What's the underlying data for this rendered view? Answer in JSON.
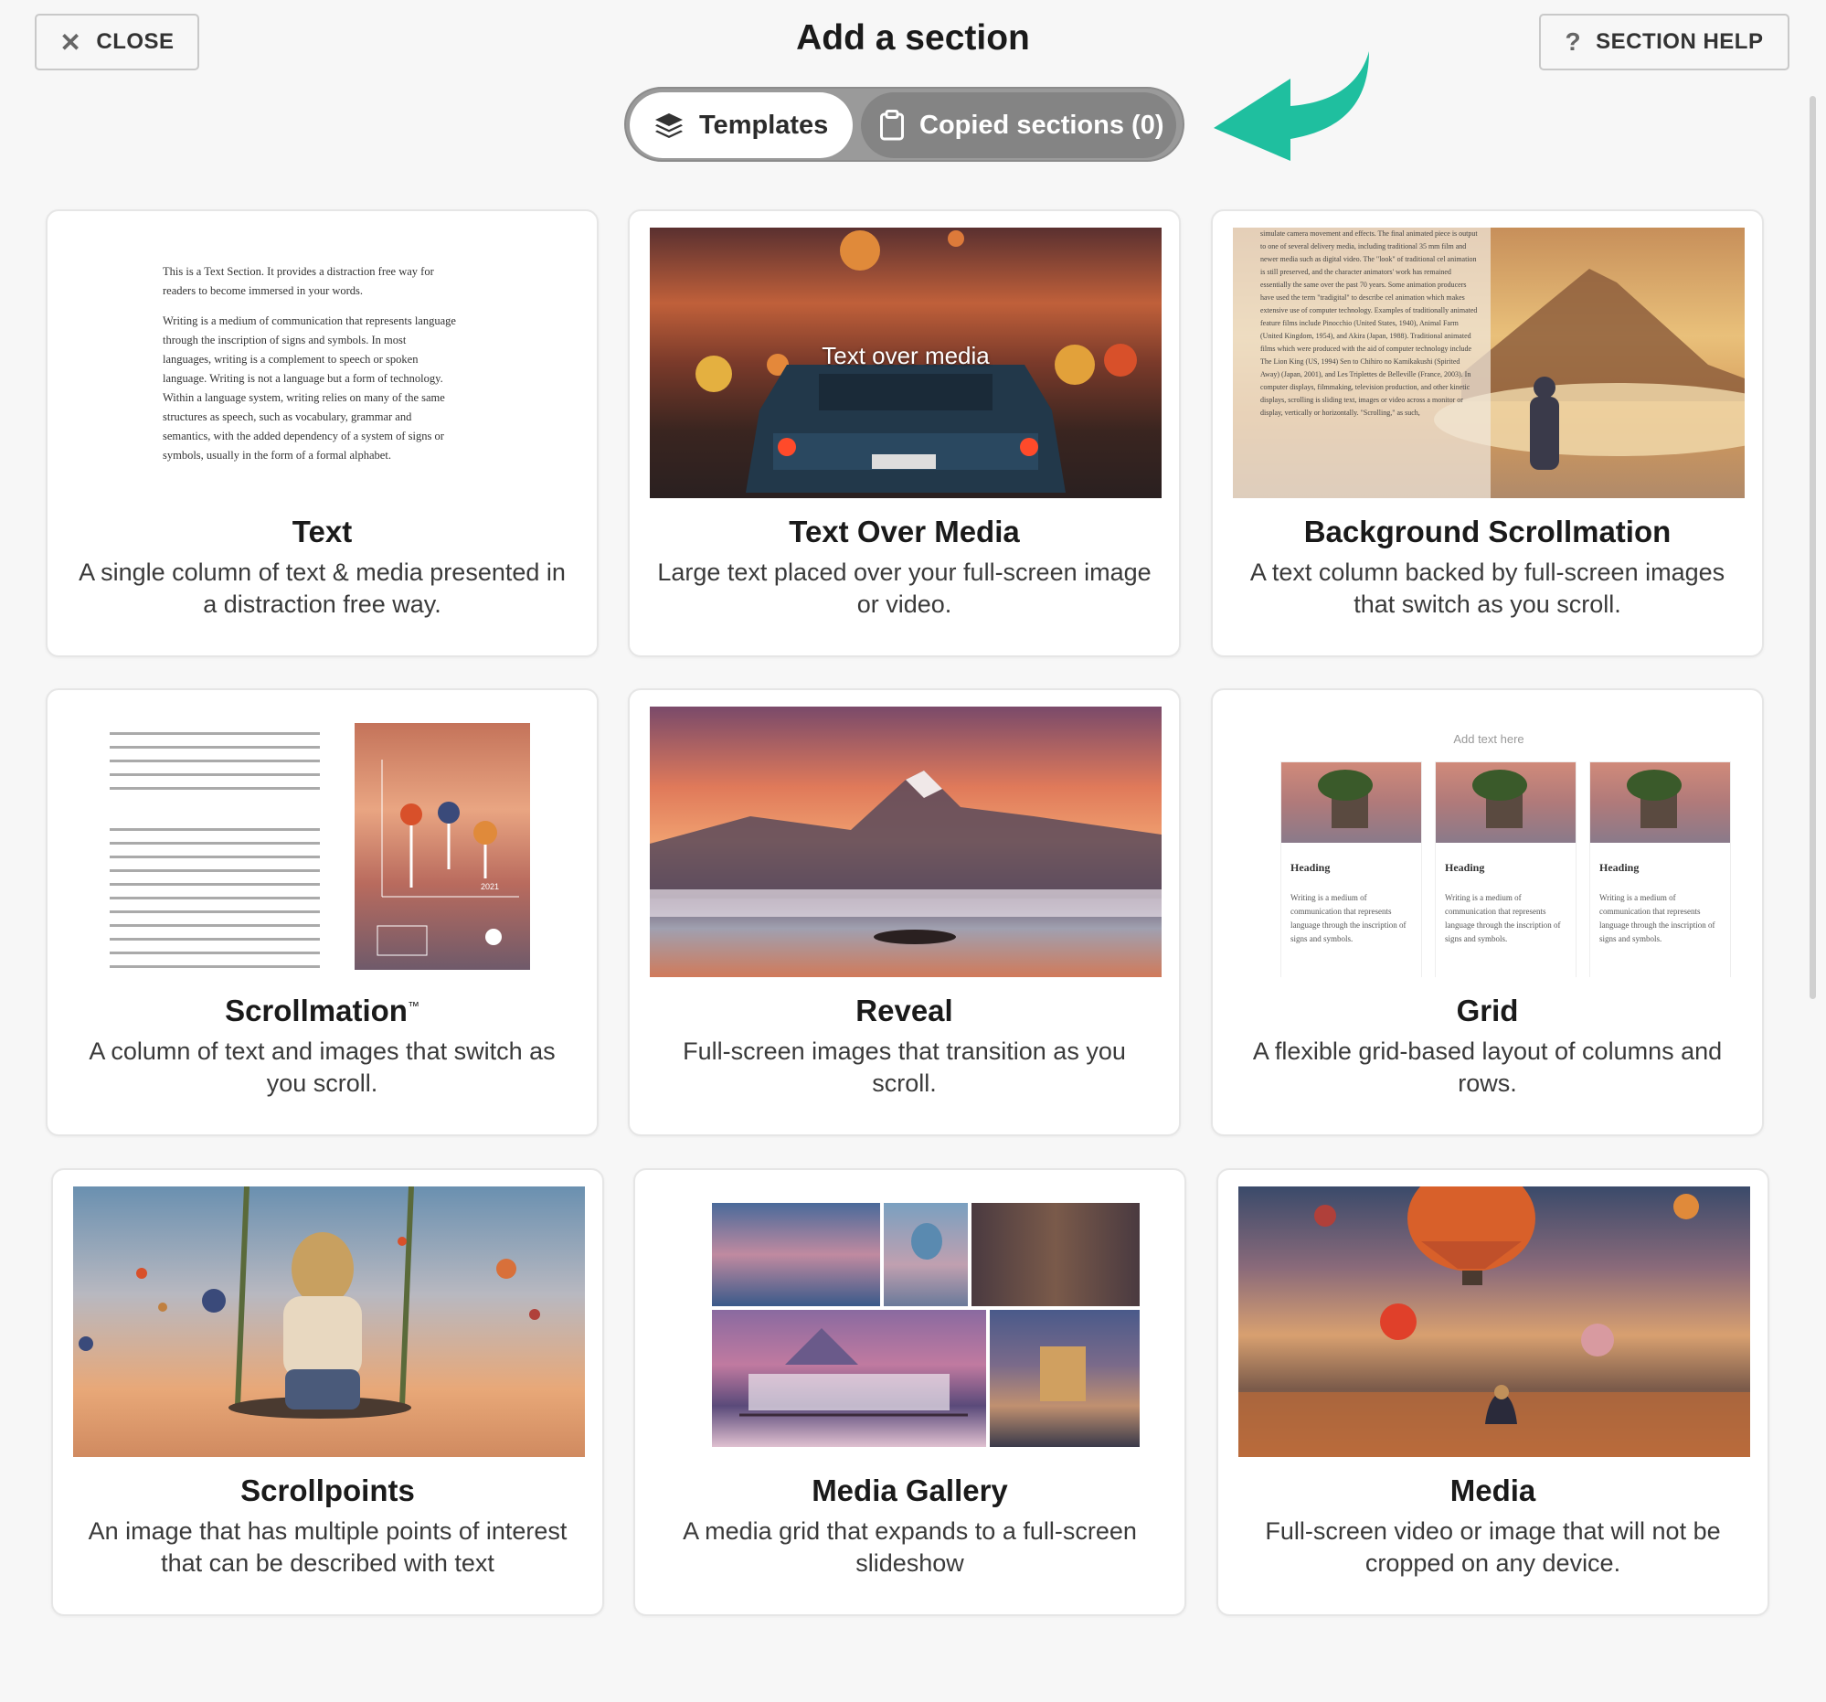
{
  "header": {
    "close_label": "CLOSE",
    "title": "Add a section",
    "help_label": "SECTION HELP"
  },
  "tabs": {
    "templates_label": "Templates",
    "copied_label": "Copied sections (0)"
  },
  "colors": {
    "accent_arrow": "#1fbf9f",
    "toggle_bg": "#9a9a9a"
  },
  "cards": [
    {
      "title": "Text",
      "desc": "A single column of text & media presented in a distraction free way."
    },
    {
      "title": "Text Over Media",
      "desc": "Large text placed over your full-screen image or video.",
      "overlay": "Text over media"
    },
    {
      "title": "Background Scrollmation",
      "desc": "A text column backed by full-screen images that switch as you scroll."
    },
    {
      "title": "Scrollmation",
      "title_mark": "™",
      "desc": "A column of text and images that switch as you scroll.",
      "chart_year": "2021"
    },
    {
      "title": "Reveal",
      "desc": "Full-screen images that transition as you scroll."
    },
    {
      "title": "Grid",
      "desc": "A flexible grid-based layout of columns and rows.",
      "add_text": "Add text here",
      "col_heading": "Heading",
      "col_text": "Writing is a medium of communication that represents language through the inscription of signs and symbols."
    },
    {
      "title": "Scrollpoints",
      "desc": "An image that has multiple points of interest that can be described with text"
    },
    {
      "title": "Media Gallery",
      "desc": "A media grid that expands to a full-screen slideshow"
    },
    {
      "title": "Media",
      "desc": "Full-screen video or image that will not be cropped on any device."
    }
  ],
  "text_thumb": {
    "p1": "This is a Text Section. It provides a distraction free way for readers to become immersed in your words.",
    "p2": "Writing is a medium of communication that represents language through the inscription of signs and symbols. In most languages, writing is a complement to speech or spoken language. Writing is not a language but a form of technology. Within a language system, writing relies on many of the same structures as speech, such as vocabulary, grammar and semantics, with the added dependency of a system of signs or symbols, usually in the form of a formal alphabet."
  },
  "bg_thumb": {
    "text": "simulate camera movement and effects. The final animated piece is output to one of several delivery media, including traditional 35 mm film and newer media such as digital video. The \"look\" of traditional cel animation is still preserved, and the character animators' work has remained essentially the same over the past 70 years. Some animation producers have used the term \"tradigital\" to describe cel animation which makes extensive use of computer technology. Examples of traditionally animated feature films include Pinocchio (United States, 1940), Animal Farm (United Kingdom, 1954), and Akira (Japan, 1988). Traditional animated films which were produced with the aid of computer technology include The Lion King (US, 1994) Sen to Chihiro no Kamikakushi (Spirited Away) (Japan, 2001), and Les Triplettes de Belleville (France, 2003). In computer displays, filmmaking, television production, and other kinetic displays, scrolling is sliding text, images or video across a monitor or display, vertically or horizontally. \"Scrolling,\" as such,"
  }
}
